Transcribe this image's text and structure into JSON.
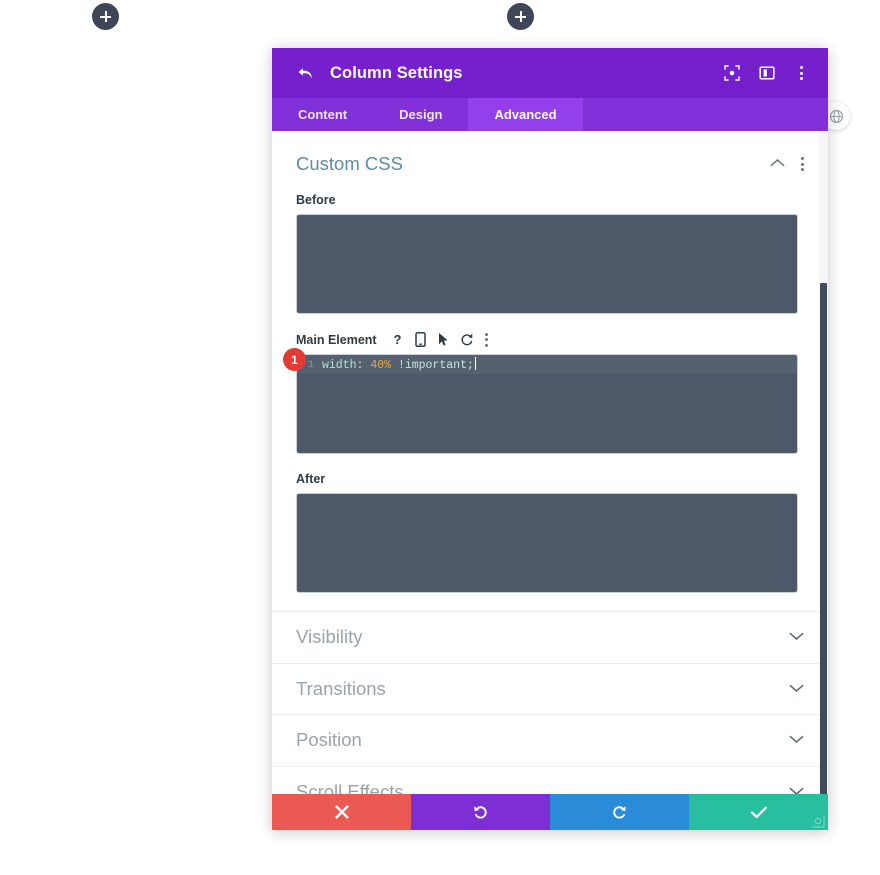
{
  "page": {
    "add_buttons": [
      {
        "name": "add-section-left",
        "icon": "plus-icon"
      },
      {
        "name": "add-section-middle",
        "icon": "plus-icon"
      }
    ],
    "globe_badge_icon": "globe-icon"
  },
  "modal": {
    "header": {
      "back_icon": "back-arrow-icon",
      "title": "Column Settings",
      "icons": [
        {
          "name": "focus-icon",
          "label": "focus"
        },
        {
          "name": "layout-panel-icon",
          "label": "layout"
        },
        {
          "name": "more-vertical-icon",
          "label": "more"
        }
      ]
    },
    "tabs": [
      {
        "label": "Content",
        "active": false
      },
      {
        "label": "Design",
        "active": false
      },
      {
        "label": "Advanced",
        "active": true
      }
    ],
    "custom_css": {
      "title": "Custom CSS",
      "collapse_icon": "chevron-up-icon",
      "kebab_icon": "more-vertical-icon",
      "before": {
        "label": "Before",
        "value": ""
      },
      "main_element": {
        "label": "Main Element",
        "icons": [
          {
            "name": "help-icon",
            "glyph": "?"
          },
          {
            "name": "mobile-icon",
            "glyph": "mobile"
          },
          {
            "name": "cursor-icon",
            "glyph": "cursor"
          },
          {
            "name": "reset-icon",
            "glyph": "undo"
          },
          {
            "name": "more-vertical-icon",
            "glyph": "kebab"
          }
        ],
        "badge": "1",
        "code": {
          "line_number": "1",
          "property": "width",
          "colon": ":",
          "value": "40%",
          "important": "!important",
          "semicolon": ";"
        }
      },
      "after": {
        "label": "After",
        "value": ""
      }
    },
    "sections": [
      {
        "label": "Visibility",
        "icon": "chevron-down-icon"
      },
      {
        "label": "Transitions",
        "icon": "chevron-down-icon"
      },
      {
        "label": "Position",
        "icon": "chevron-down-icon"
      },
      {
        "label": "Scroll Effects",
        "icon": "chevron-down-icon"
      }
    ],
    "footer": [
      {
        "name": "cancel-button",
        "icon": "close-icon"
      },
      {
        "name": "undo-button",
        "icon": "undo-icon"
      },
      {
        "name": "redo-button",
        "icon": "redo-icon"
      },
      {
        "name": "save-button",
        "icon": "check-icon"
      }
    ]
  },
  "colors": {
    "header_purple": "#7620cd",
    "tabbar_purple": "#8230d9",
    "tab_active_purple": "#9340ec",
    "textarea_slate": "#4d5968",
    "section_title_blue": "#5b8ca8",
    "badge_red": "#e03b34",
    "cancel_red": "#ea5a52",
    "undo_purple": "#7d2ed4",
    "redo_blue": "#2a8bd8",
    "save_green": "#27bfa0",
    "code_value_orange": "#e8a33d"
  }
}
